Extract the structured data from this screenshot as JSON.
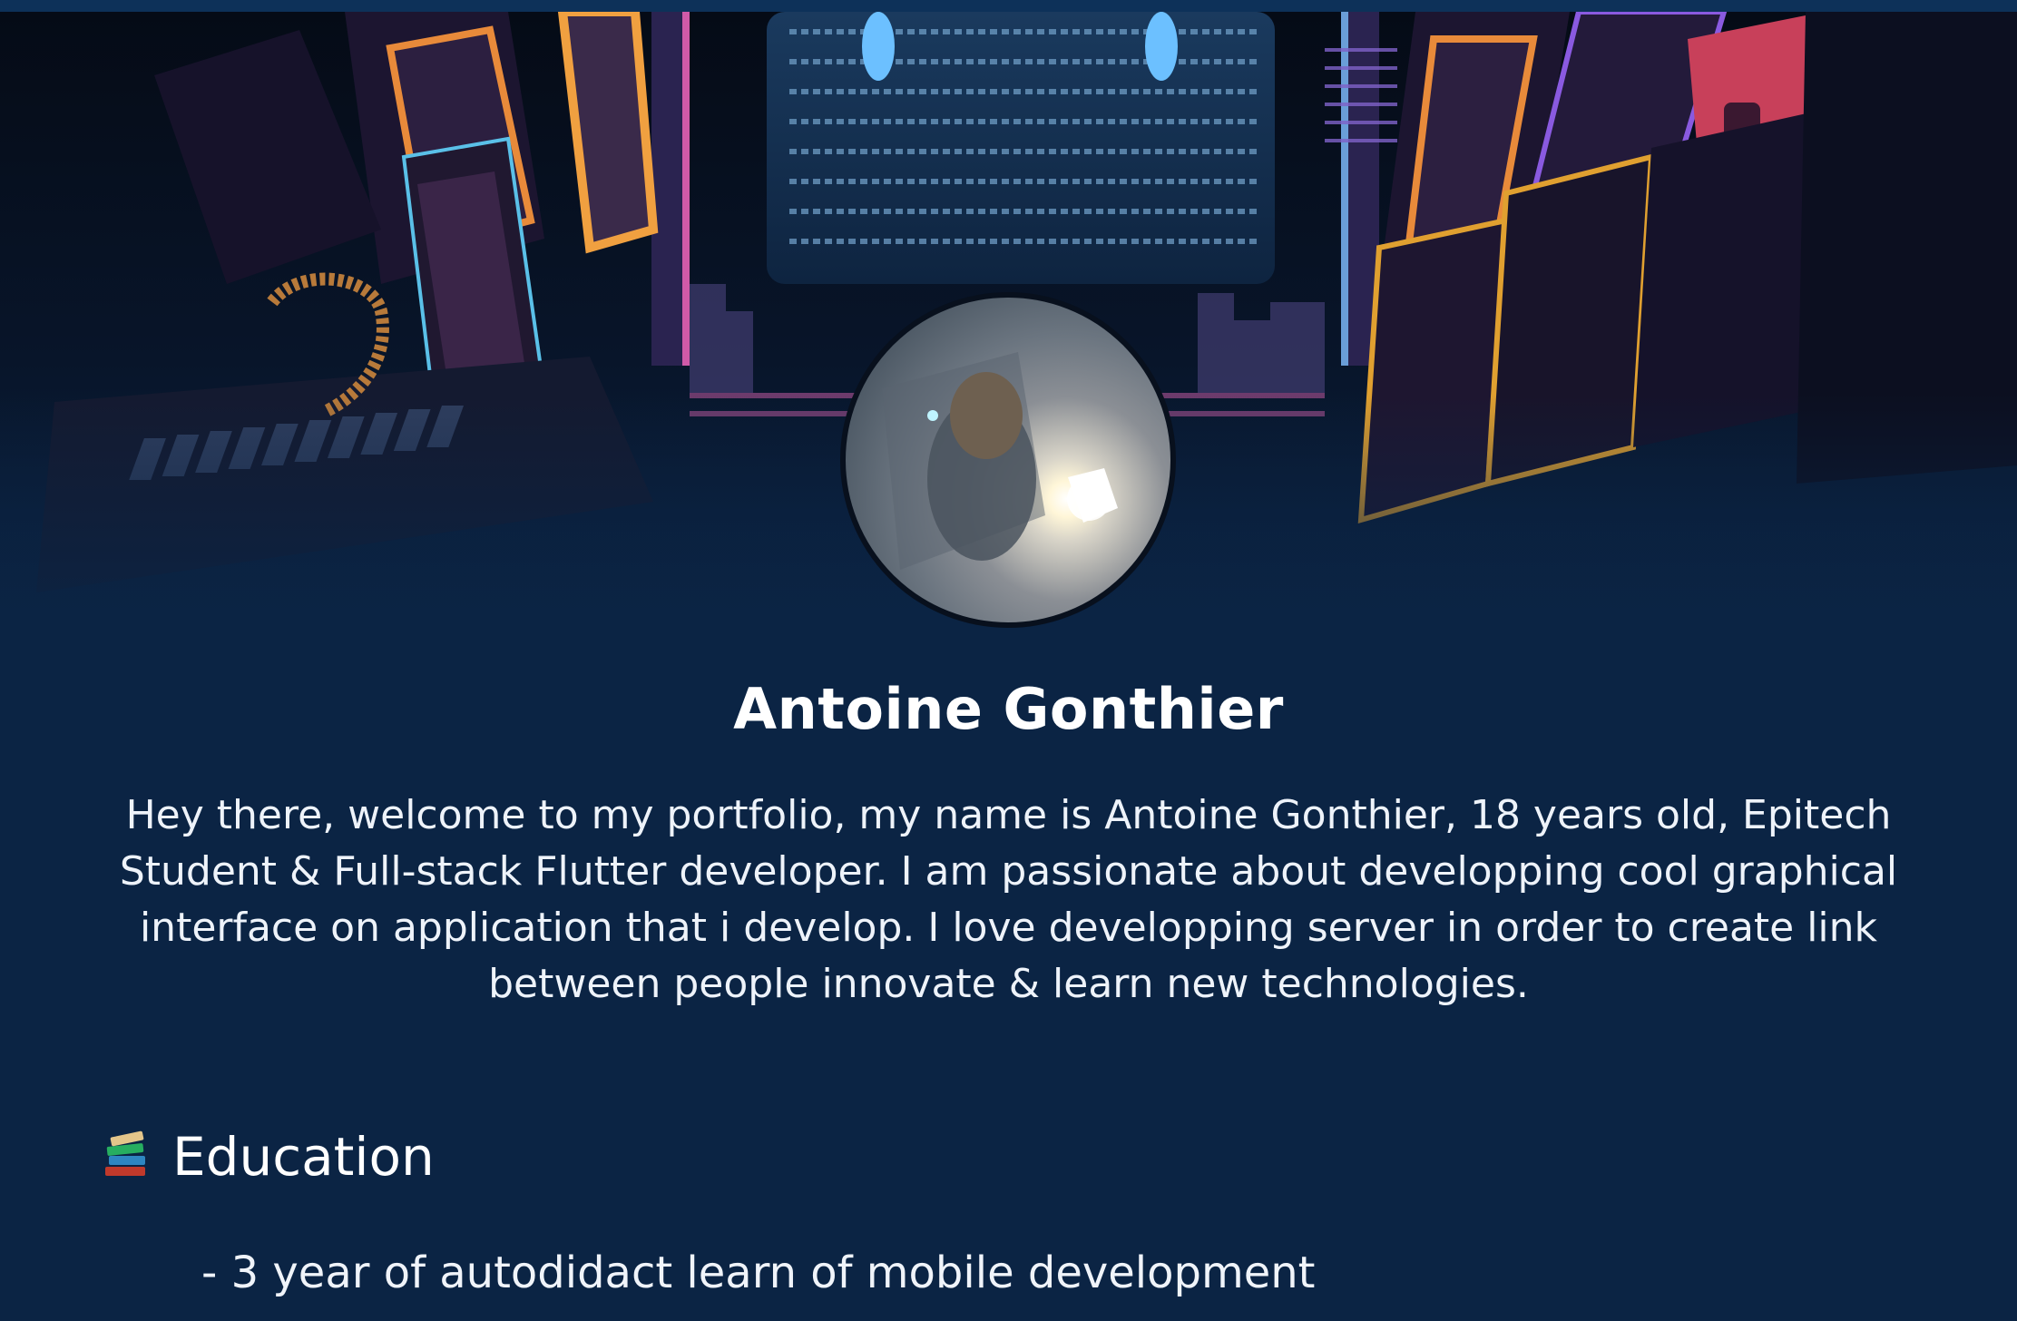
{
  "profile": {
    "name": "Antoine Gonthier",
    "bio": "Hey there, welcome to my portfolio, my name is Antoine Gonthier, 18 years old, Epitech Student & Full-stack Flutter developer. I am passionate about developping cool graphical interface on application that i develop. I love developping server in order to create link between people innovate & learn new technologies."
  },
  "education": {
    "icon": "books-icon",
    "title": "Education",
    "items": [
      "- 3 year of autodidact learn of mobile development"
    ]
  },
  "colors": {
    "page_background": "#0b2444",
    "top_bar": "#0d3159",
    "text": "#ffffff"
  }
}
